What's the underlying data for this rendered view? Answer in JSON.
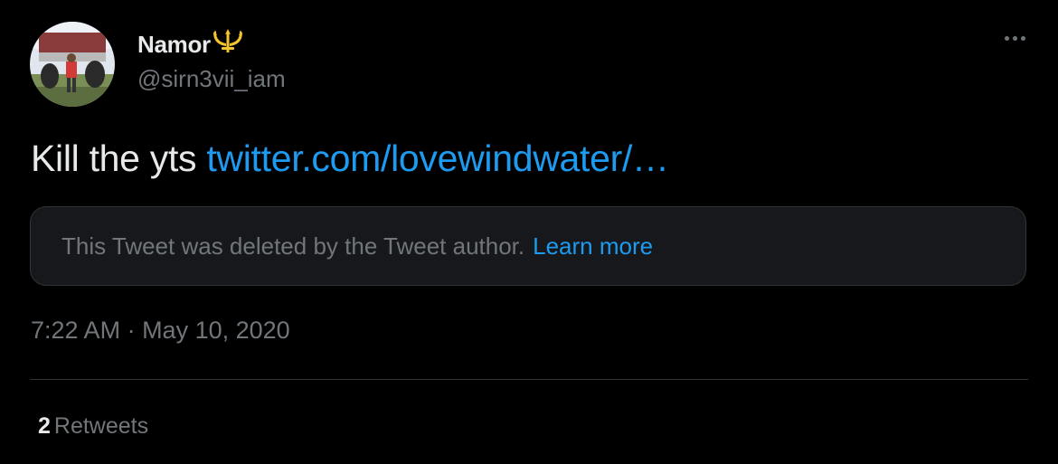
{
  "author": {
    "display_name": "Namor",
    "handle": "@sirn3vii_iam",
    "badge_icon": "trident-icon",
    "avatar_icon": "profile-photo"
  },
  "menu_icon": "more-options-icon",
  "tweet": {
    "text": "Kill the yts ",
    "link_text": "twitter.com/lovewindwater/…"
  },
  "quoted_tweet": {
    "deleted_notice": "This Tweet was deleted by the Tweet author.",
    "learn_more": "Learn more"
  },
  "timestamp": {
    "time": "7:22 AM",
    "separator": " · ",
    "date": "May 10, 2020"
  },
  "stats": {
    "retweets_count": "2",
    "retweets_label": "Retweets"
  },
  "colors": {
    "background": "#000000",
    "text_primary": "#e7e9ea",
    "text_secondary": "#71767b",
    "link": "#1d9bf0",
    "badge": "#f4c430",
    "border": "#2f3336"
  }
}
